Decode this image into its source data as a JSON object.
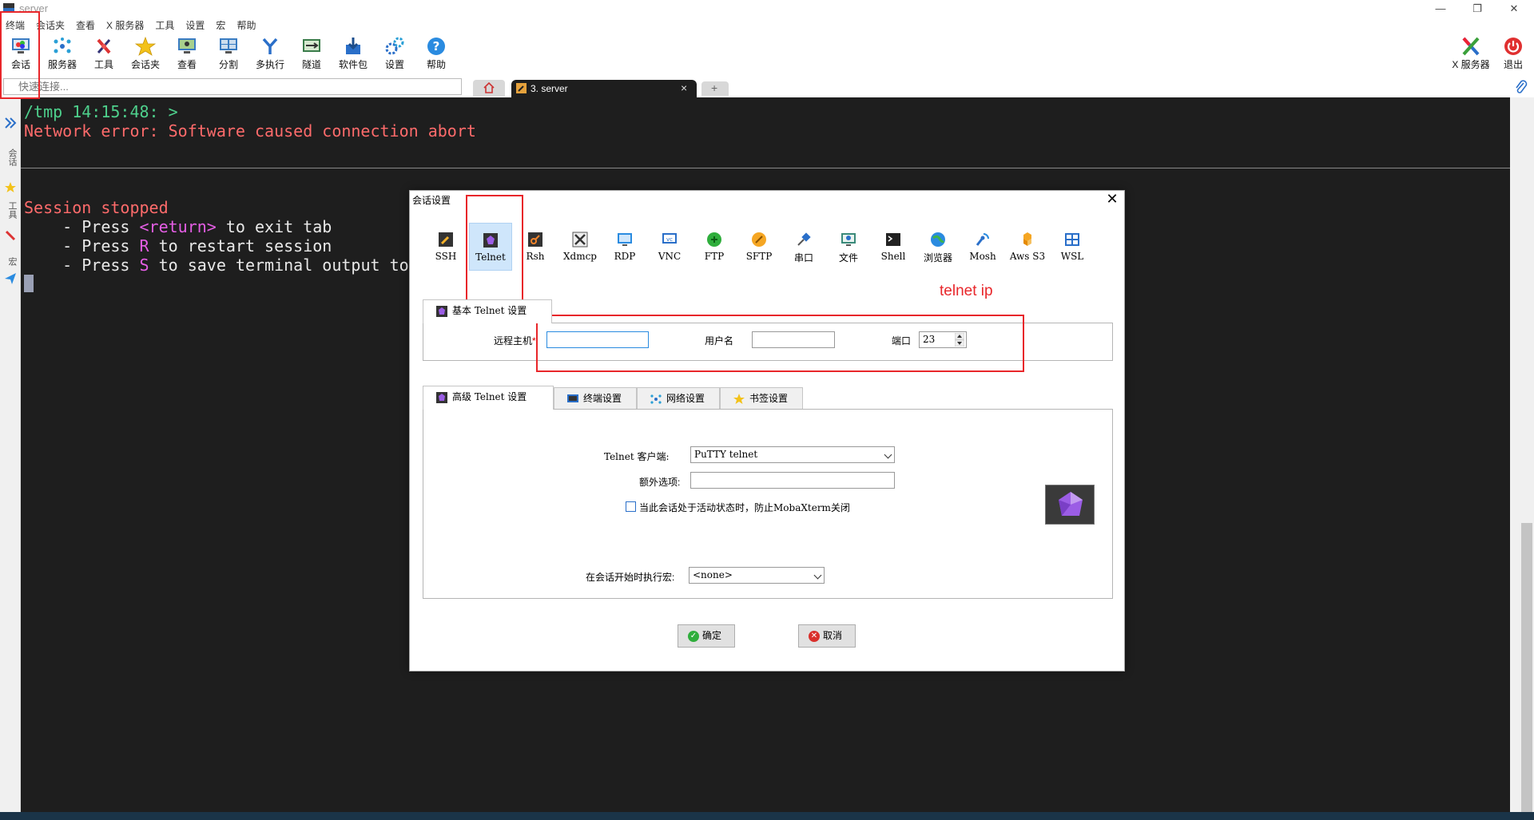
{
  "window": {
    "title": "server",
    "minimize": "—",
    "restore": "❐",
    "close": "✕"
  },
  "menu": [
    "终端",
    "会话夹",
    "查看",
    "X 服务器",
    "工具",
    "设置",
    "宏",
    "帮助"
  ],
  "toolbar": {
    "left": [
      {
        "label": "会话",
        "icon": "session-monitor-icon"
      },
      {
        "label": "服务器",
        "icon": "servers-icon"
      },
      {
        "label": "工具",
        "icon": "tools-icon"
      },
      {
        "label": "会话夹",
        "icon": "star-icon"
      },
      {
        "label": "查看",
        "icon": "view-icon"
      },
      {
        "label": "分割",
        "icon": "split-icon"
      },
      {
        "label": "多执行",
        "icon": "multiexec-icon"
      },
      {
        "label": "隧道",
        "icon": "tunnel-icon"
      },
      {
        "label": "软件包",
        "icon": "packages-icon"
      },
      {
        "label": "设置",
        "icon": "settings-gears-icon"
      },
      {
        "label": "帮助",
        "icon": "help-icon"
      }
    ],
    "right": [
      {
        "label": "X 服务器",
        "icon": "x-server-icon"
      },
      {
        "label": "退出",
        "icon": "power-icon"
      }
    ]
  },
  "quick_connect": {
    "placeholder": "快速连接..."
  },
  "tabs": {
    "session_tab_label": "3. server",
    "close": "×",
    "new_tab": "+"
  },
  "sidebar": {
    "items": [
      "会话",
      "工具",
      "宏"
    ]
  },
  "terminal": {
    "prompt": "/tmp 14:15:48: >",
    "error": "Network error: Software caused connection abort",
    "stopped": "Session stopped",
    "l1_pre": "    - Press ",
    "l1_key": "<return>",
    "l1_post": " to exit tab",
    "l2_pre": "    - Press ",
    "l2_key": "R",
    "l2_post": " to restart session",
    "l3_pre": "    - Press ",
    "l3_key": "S",
    "l3_post": " to save terminal output to file"
  },
  "dialog": {
    "title": "会话设置",
    "close": "✕",
    "session_types": [
      {
        "label": "SSH",
        "icon": "ssh-icon",
        "selected": false
      },
      {
        "label": "Telnet",
        "icon": "telnet-icon",
        "selected": true
      },
      {
        "label": "Rsh",
        "icon": "rsh-icon",
        "selected": false
      },
      {
        "label": "Xdmcp",
        "icon": "xdmcp-icon",
        "selected": false
      },
      {
        "label": "RDP",
        "icon": "rdp-icon",
        "selected": false
      },
      {
        "label": "VNC",
        "icon": "vnc-icon",
        "selected": false
      },
      {
        "label": "FTP",
        "icon": "ftp-icon",
        "selected": false
      },
      {
        "label": "SFTP",
        "icon": "sftp-icon",
        "selected": false
      },
      {
        "label": "串口",
        "icon": "serial-icon",
        "selected": false
      },
      {
        "label": "文件",
        "icon": "file-icon",
        "selected": false
      },
      {
        "label": "Shell",
        "icon": "shell-icon",
        "selected": false
      },
      {
        "label": "浏览器",
        "icon": "browser-icon",
        "selected": false
      },
      {
        "label": "Mosh",
        "icon": "mosh-icon",
        "selected": false
      },
      {
        "label": "Aws S3",
        "icon": "aws-s3-icon",
        "selected": false
      },
      {
        "label": "WSL",
        "icon": "wsl-icon",
        "selected": false
      }
    ],
    "basic": {
      "tab_label": "基本 Telnet 设置",
      "remote_host_label": "远程主机",
      "remote_host_required": "*",
      "remote_host_value": "",
      "username_label": "用户名",
      "username_value": "",
      "port_label": "端口",
      "port_value": "23"
    },
    "advanced_tabs": [
      "高级 Telnet 设置",
      "终端设置",
      "网络设置",
      "书签设置"
    ],
    "advanced": {
      "client_label": "Telnet 客户端:",
      "client_value": "PuTTY telnet",
      "extra_label": "额外选项:",
      "extra_value": "",
      "prevent_close_label": "当此会话处于活动状态时，防止MobaXterm关闭",
      "prevent_close_checked": false,
      "macro_label": "在会话开始时执行宏:",
      "macro_value": "<none>"
    },
    "ok_label": "确定",
    "cancel_label": "取消"
  },
  "annotation": {
    "text": "telnet ip"
  },
  "colors": {
    "terminal_bg": "#1e1e1e",
    "prompt": "#4ed08c",
    "error": "#ff6b6b",
    "key_magenta": "#e55ee5",
    "annotation_red": "#e8262a",
    "selection": "#cfe6fb"
  }
}
